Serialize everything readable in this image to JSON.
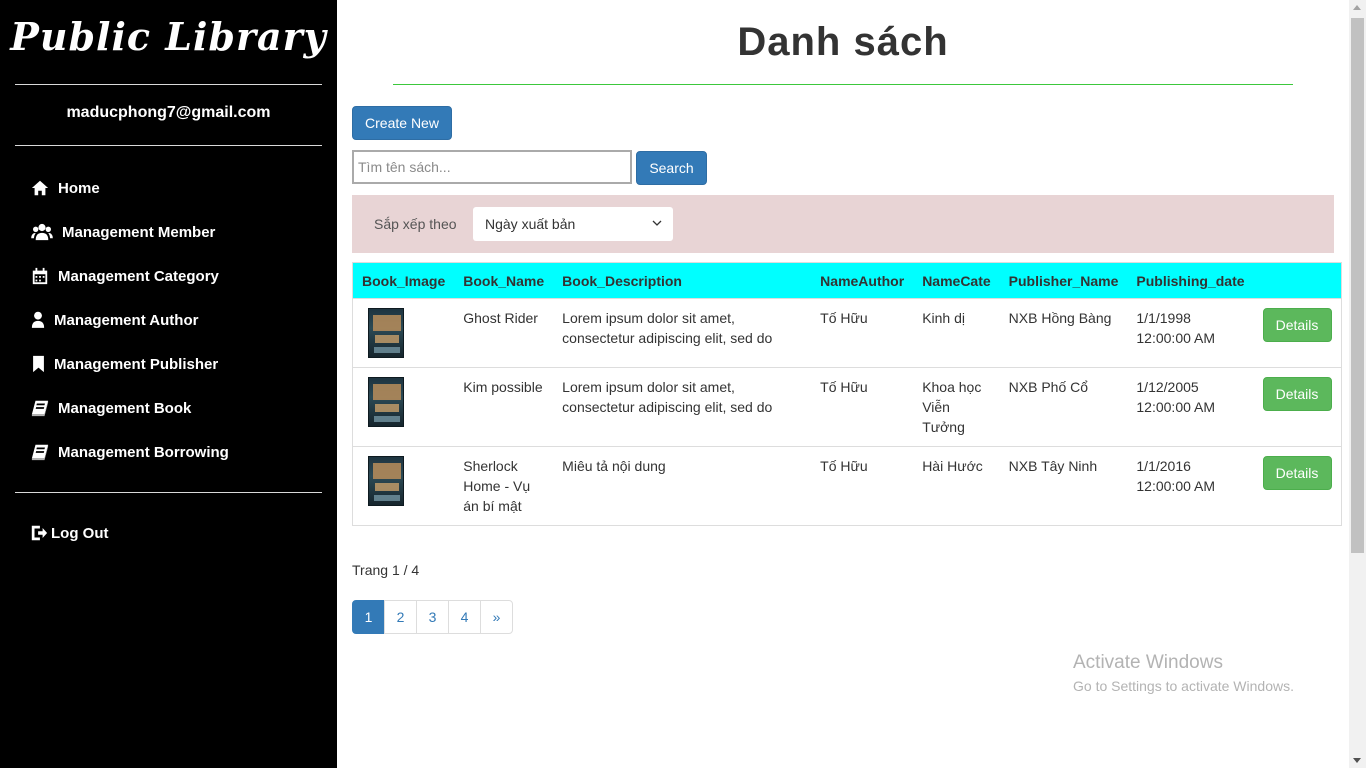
{
  "sidebar": {
    "brand": "Public Library",
    "user_email": "maducphong7@gmail.com",
    "items": [
      {
        "label": "Home",
        "icon": "home-icon"
      },
      {
        "label": "Management Member",
        "icon": "users-icon"
      },
      {
        "label": "Management Category",
        "icon": "calendar-icon"
      },
      {
        "label": "Management Author",
        "icon": "user-icon"
      },
      {
        "label": "Management Publisher",
        "icon": "bookmark-icon"
      },
      {
        "label": "Management Book",
        "icon": "book-icon"
      },
      {
        "label": "Management Borrowing",
        "icon": "book-icon"
      }
    ],
    "logout_label": "Log Out",
    "logout_icon": "logout-icon"
  },
  "main": {
    "title": "Danh sách",
    "create_label": "Create New",
    "search": {
      "placeholder": "Tìm tên sách...",
      "value": "",
      "button_label": "Search"
    },
    "sort": {
      "label": "Sắp xếp theo",
      "selected": "Ngày xuất bản"
    },
    "table": {
      "columns": [
        "Book_Image",
        "Book_Name",
        "Book_Description",
        "NameAuthor",
        "NameCate",
        "Publisher_Name",
        "Publishing_date",
        ""
      ],
      "rows": [
        {
          "name": "Ghost Rider",
          "description": "Lorem ipsum dolor sit amet, consectetur adipiscing elit, sed do eiusmod tempor incididunt",
          "author": "Tố Hữu",
          "category": "Kinh dị",
          "publisher": "NXB Hồng Bàng",
          "date": "1/1/1998",
          "time": "12:00:00 AM",
          "action": "Details"
        },
        {
          "name": "Kim possible",
          "description": "Lorem ipsum dolor sit amet, consectetur adipiscing elit, sed do eiusmod tempor incididunt",
          "author": "Tố Hữu",
          "category": "Khoa học Viễn Tưởng",
          "publisher": "NXB Phố Cổ",
          "date": "1/12/2005",
          "time": "12:00:00 AM",
          "action": "Details"
        },
        {
          "name": "Sherlock Home - Vụ án bí mật",
          "description": "Miêu tả nội dung",
          "author": "Tố Hữu",
          "category": "Hài Hước",
          "publisher": "NXB Tây Ninh",
          "date": "1/1/2016",
          "time": "12:00:00 AM",
          "action": "Details"
        }
      ]
    },
    "page_info": "Trang 1 / 4",
    "pagination": [
      "1",
      "2",
      "3",
      "4",
      "»"
    ],
    "current_page": "1"
  },
  "watermark": {
    "line1": "Activate Windows",
    "line2": "Go to Settings to activate Windows."
  }
}
